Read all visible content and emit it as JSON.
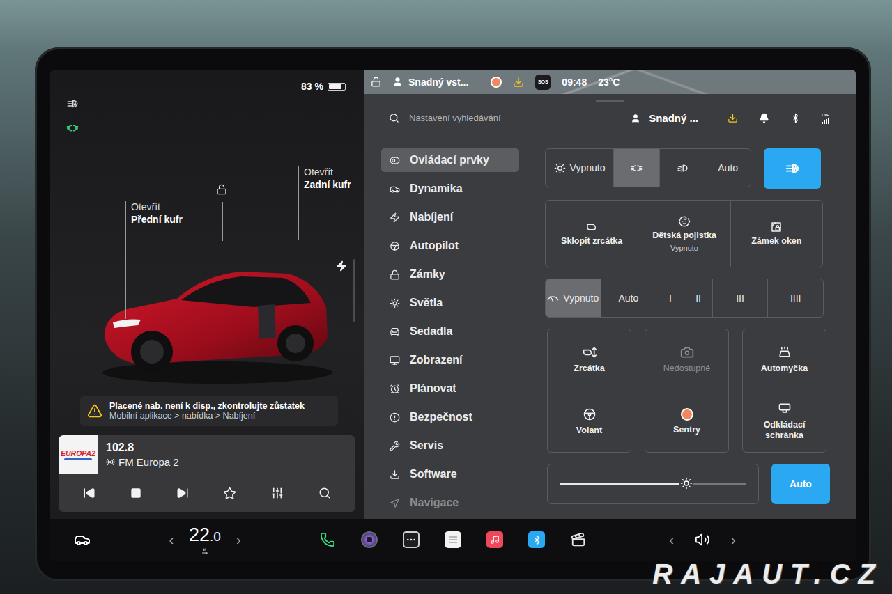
{
  "status_bar": {
    "profile": "Snadný vst...",
    "recording": true,
    "sos": "SOS",
    "time": "09:48",
    "temperature": "23°C"
  },
  "vehicle": {
    "battery": "83 %",
    "battery_level": 0.83,
    "indicators": [
      {
        "kind": "auto-high-beam",
        "color": "#d8d8d8"
      },
      {
        "kind": "parking-lights",
        "color": "#37d67a"
      }
    ],
    "callouts": [
      {
        "action": "Otevřít",
        "target": "Přední kufr"
      },
      {
        "action": "Otevřít",
        "target": "Zadní kufr"
      }
    ],
    "locked": false,
    "charge_port": true
  },
  "alert": {
    "title": "Placené nab. není k disp., zkontrolujte zůstatek",
    "path": "Mobilní aplikace > nabídka > Nabíjení"
  },
  "media": {
    "logo": "EUROPA2",
    "frequency": "102.8",
    "station": "FM Europa 2",
    "playing": true,
    "favorite": false
  },
  "search": {
    "placeholder": "Nastavení vyhledávání"
  },
  "header": {
    "profile": "Snadný ...",
    "lte": "LTE"
  },
  "sidebar": {
    "items": [
      {
        "label": "Ovládací prvky",
        "selected": true,
        "faded": false
      },
      {
        "label": "Dynamika",
        "selected": false,
        "faded": false
      },
      {
        "label": "Nabíjení",
        "selected": false,
        "faded": false
      },
      {
        "label": "Autopilot",
        "selected": false,
        "faded": false
      },
      {
        "label": "Zámky",
        "selected": false,
        "faded": false
      },
      {
        "label": "Světla",
        "selected": false,
        "faded": false
      },
      {
        "label": "Sedadla",
        "selected": false,
        "faded": false
      },
      {
        "label": "Zobrazení",
        "selected": false,
        "faded": false
      },
      {
        "label": "Plánovat",
        "selected": false,
        "faded": false
      },
      {
        "label": "Bezpečnost",
        "selected": false,
        "faded": false
      },
      {
        "label": "Servis",
        "selected": false,
        "faded": false
      },
      {
        "label": "Software",
        "selected": false,
        "faded": false
      },
      {
        "label": "Navigace",
        "selected": false,
        "faded": true
      }
    ]
  },
  "headlights": [
    {
      "kind": "off",
      "label": "Vypnuto",
      "selected": false
    },
    {
      "kind": "parking",
      "label": "",
      "selected": true
    },
    {
      "kind": "low-beam",
      "label": "",
      "selected": false
    },
    {
      "kind": "auto",
      "label": "Auto",
      "selected": false
    }
  ],
  "auto_high_beam": {
    "on": true
  },
  "quick_tiles": [
    {
      "kind": "mirror-fold",
      "label": "Sklopit zrcátka",
      "sub": ""
    },
    {
      "kind": "child-lock",
      "label": "Dětská pojistka",
      "sub": "Vypnuto"
    },
    {
      "kind": "window-lock",
      "label": "Zámek oken",
      "sub": ""
    }
  ],
  "wipers": [
    {
      "kind": "off",
      "label": "Vypnuto",
      "selected": true
    },
    {
      "kind": "text",
      "label": "Auto",
      "selected": false
    },
    {
      "kind": "text",
      "label": "I",
      "selected": false
    },
    {
      "kind": "text",
      "label": "II",
      "selected": false
    },
    {
      "kind": "text",
      "label": "III",
      "selected": false
    },
    {
      "kind": "text",
      "label": "IIII",
      "selected": false
    }
  ],
  "buttons": [
    {
      "kind": "mirror-adjust",
      "label": "Zrcátka",
      "disabled": false,
      "active": false
    },
    {
      "kind": "dashcam",
      "label": "Nedostupné",
      "disabled": true,
      "active": false
    },
    {
      "kind": "carwash",
      "label": "Automyčka",
      "disabled": false,
      "active": false
    },
    {
      "kind": "steering",
      "label": "Volant",
      "disabled": false,
      "active": false
    },
    {
      "kind": "sentry",
      "label": "Sentry",
      "disabled": false,
      "active": true
    },
    {
      "kind": "glovebox",
      "label": "Odkládací schránka",
      "disabled": false,
      "active": false
    }
  ],
  "brightness": {
    "level": 0.68,
    "auto_label": "Auto",
    "auto": true
  },
  "dock": {
    "temperature": {
      "value": "22",
      "decimal": ".0",
      "left_arrow": "‹",
      "right_arrow": "›"
    },
    "apps": [
      {
        "kind": "phone"
      },
      {
        "kind": "camera"
      },
      {
        "kind": "more"
      },
      {
        "kind": "notes"
      },
      {
        "kind": "music"
      },
      {
        "kind": "bluetooth"
      },
      {
        "kind": "video"
      }
    ],
    "volume": {
      "left_arrow": "‹",
      "right_arrow": "›"
    }
  },
  "watermark": "RAJAUT.CZ"
}
